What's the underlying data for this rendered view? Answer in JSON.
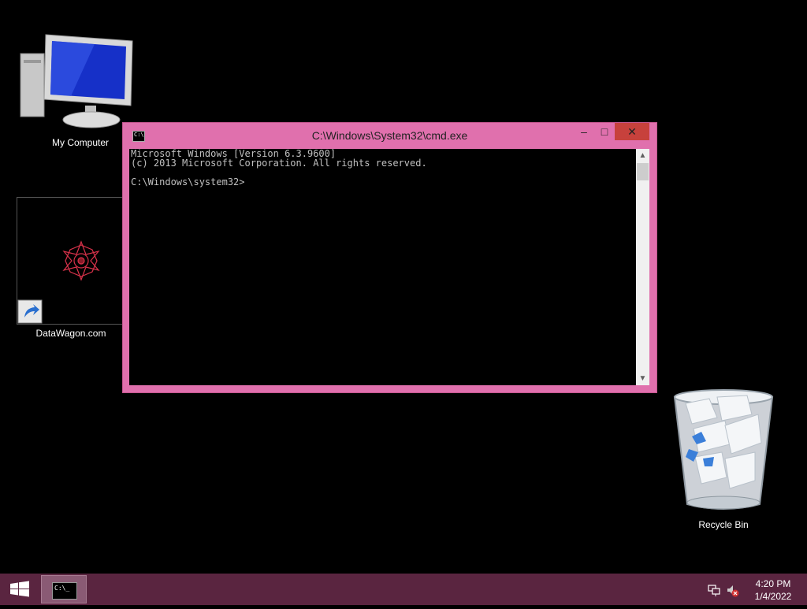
{
  "desktop": {
    "icons": [
      {
        "label": "My Computer"
      },
      {
        "label": "DataWagon.com"
      },
      {
        "label": "Recycle Bin"
      }
    ]
  },
  "window": {
    "title": "C:\\Windows\\System32\\cmd.exe",
    "sysicon_text": "C:\\",
    "console_lines": [
      "Microsoft Windows [Version 6.3.9600]",
      "(c) 2013 Microsoft Corporation. All rights reserved.",
      "",
      "C:\\Windows\\system32>"
    ],
    "minimize": "–",
    "maximize": "□",
    "close": "✕"
  },
  "taskbar": {
    "task_icon_text": "C:\\_",
    "time": "4:20 PM",
    "date": "1/4/2022"
  },
  "colors": {
    "window_frame": "#e070ad",
    "taskbar": "#5a2540",
    "close_button": "#c7413c"
  }
}
